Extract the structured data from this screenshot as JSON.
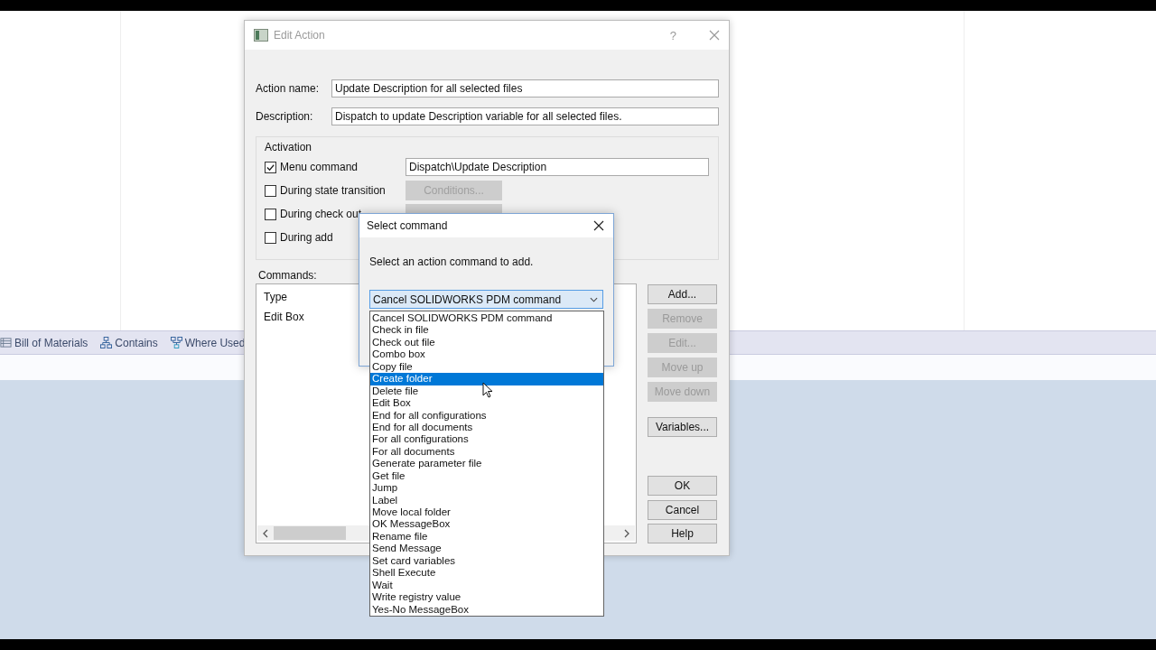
{
  "background_app": {
    "tabs": [
      {
        "label": "Bill of Materials",
        "kind": "bom"
      },
      {
        "label": "Contains",
        "kind": "contains"
      },
      {
        "label": "Where Used",
        "kind": "where_used"
      }
    ]
  },
  "edit_action": {
    "title": "Edit Action",
    "help": "?",
    "action_name": {
      "label": "Action name:",
      "value": "Update Description for all selected files"
    },
    "description": {
      "label": "Description:",
      "value": "Dispatch to update Description variable for all selected files."
    },
    "activation": {
      "title": "Activation",
      "items": [
        {
          "label": "Menu command",
          "checked": true,
          "kind": "field",
          "value": "Dispatch\\Update Description"
        },
        {
          "label": "During state transition",
          "checked": false,
          "kind": "button",
          "button": "Conditions...",
          "disabled": true
        },
        {
          "label": "During check out",
          "checked": false,
          "kind": "covered"
        },
        {
          "label": "During add",
          "checked": false,
          "kind": "none"
        }
      ]
    },
    "commands": {
      "label": "Commands:",
      "rows": [
        "Type",
        "Edit Box"
      ]
    },
    "buttons": [
      {
        "label": "Add...",
        "disabled": false
      },
      {
        "label": "Remove",
        "disabled": true
      },
      {
        "label": "Edit...",
        "disabled": true
      },
      {
        "label": "Move up",
        "disabled": true
      },
      {
        "label": "Move down",
        "disabled": true
      },
      {
        "label": "Variables...",
        "disabled": false
      },
      {
        "label": "OK",
        "disabled": false
      },
      {
        "label": "Cancel",
        "disabled": false
      },
      {
        "label": "Help",
        "disabled": false
      }
    ]
  },
  "select_command": {
    "title": "Select command",
    "prompt": "Select an action command to add.",
    "combo": {
      "value": "Cancel SOLIDWORKS PDM command"
    },
    "options": [
      {
        "label": "Cancel SOLIDWORKS PDM command",
        "selected": false
      },
      {
        "label": "Check in file",
        "selected": false
      },
      {
        "label": "Check out file",
        "selected": false
      },
      {
        "label": "Combo box",
        "selected": false
      },
      {
        "label": "Copy file",
        "selected": false
      },
      {
        "label": "Create folder",
        "selected": true
      },
      {
        "label": "Delete file",
        "selected": false
      },
      {
        "label": "Edit Box",
        "selected": false
      },
      {
        "label": "End for all configurations",
        "selected": false
      },
      {
        "label": "End for all documents",
        "selected": false
      },
      {
        "label": "For all configurations",
        "selected": false
      },
      {
        "label": "For all documents",
        "selected": false
      },
      {
        "label": "Generate parameter file",
        "selected": false
      },
      {
        "label": "Get file",
        "selected": false
      },
      {
        "label": "Jump",
        "selected": false
      },
      {
        "label": "Label",
        "selected": false
      },
      {
        "label": "Move local folder",
        "selected": false
      },
      {
        "label": "OK MessageBox",
        "selected": false
      },
      {
        "label": "Rename file",
        "selected": false
      },
      {
        "label": "Send Message",
        "selected": false
      },
      {
        "label": "Set card variables",
        "selected": false
      },
      {
        "label": "Shell Execute",
        "selected": false
      },
      {
        "label": "Wait",
        "selected": false
      },
      {
        "label": "Write registry value",
        "selected": false
      },
      {
        "label": "Yes-No MessageBox",
        "selected": false
      }
    ]
  }
}
